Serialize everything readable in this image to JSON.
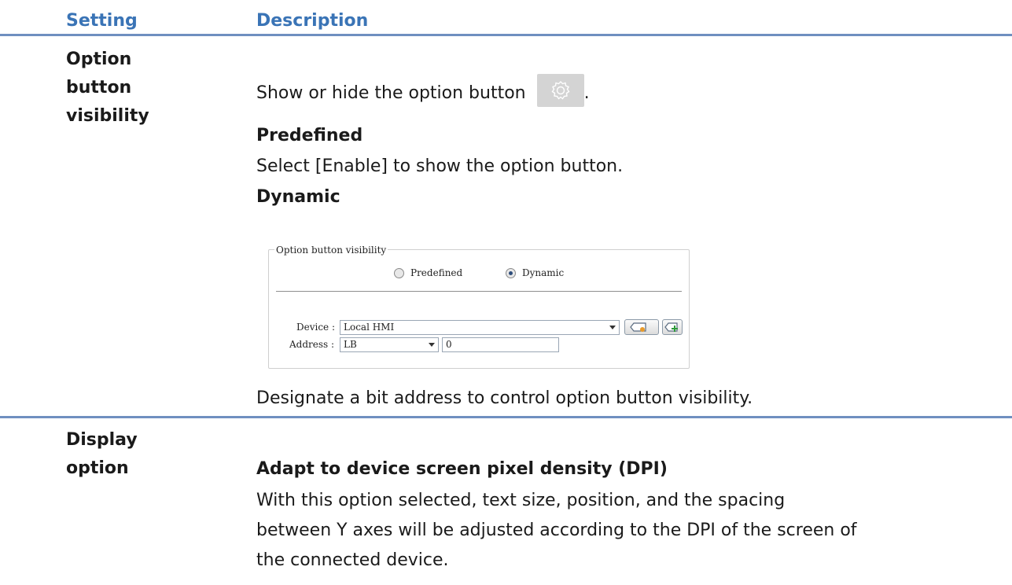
{
  "table": {
    "header_setting": "Setting",
    "header_description": "Description"
  },
  "rows": [
    {
      "setting_lines": [
        "Option",
        "button",
        "visibility"
      ],
      "intro": "Show or hide the option button",
      "intro_end": ".",
      "predefined_heading": "Predefined",
      "predefined_text": "Select [Enable] to show the option button.",
      "dynamic_heading": "Dynamic",
      "footer_text": "Designate a bit address to control option button visibility."
    },
    {
      "setting_lines": [
        "Display",
        "option"
      ],
      "heading": "Adapt to device screen pixel density (DPI)",
      "body_lines": [
        "With this option selected, text size, position, and the spacing",
        "between Y axes will be adjusted according to the DPI of the screen of",
        "the connected device."
      ]
    }
  ],
  "dialog": {
    "legend": "Option button visibility",
    "radio_predefined": "Predefined",
    "radio_dynamic": "Dynamic",
    "selected": "Dynamic",
    "device_label": "Device :",
    "device_value": "Local HMI",
    "address_label": "Address :",
    "address_type": "LB",
    "address_value": "0"
  },
  "icons": {
    "option_button": "gear-icon",
    "address_picker": "tag-pick-icon",
    "address_add": "tag-add-icon"
  },
  "colors": {
    "header_text": "#3a74b6",
    "rule": "#6f8fc0"
  }
}
